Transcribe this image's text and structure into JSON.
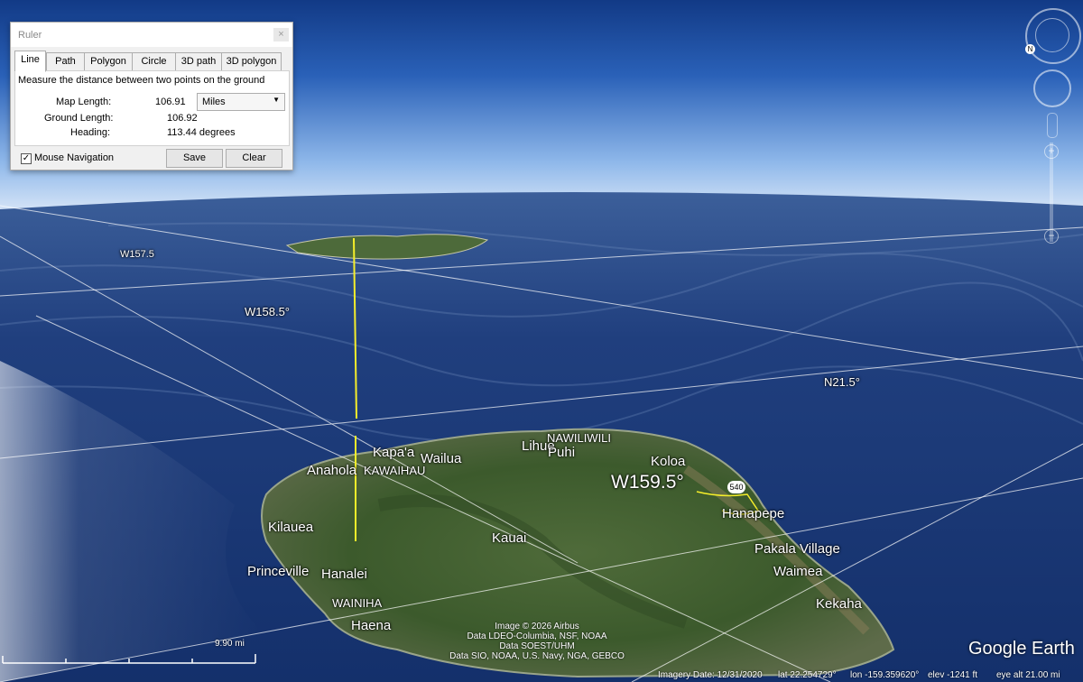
{
  "ruler": {
    "title": "Ruler",
    "tabs": [
      "Line",
      "Path",
      "Polygon",
      "Circle",
      "3D path",
      "3D polygon"
    ],
    "active_tab": "Line",
    "description": "Measure the distance between two points on the ground",
    "map_length_label": "Map Length:",
    "map_length_value": "106.91",
    "units_selected": "Miles",
    "ground_length_label": "Ground Length:",
    "ground_length_value": "106.92",
    "heading_label": "Heading:",
    "heading_value": "113.44 degrees",
    "mouse_navigation_label": "Mouse Navigation",
    "mouse_navigation_checked": true,
    "save_label": "Save",
    "clear_label": "Clear"
  },
  "map": {
    "grid_labels": {
      "w157_5": "W157.5",
      "w158_5": "W158.5°",
      "n21_5": "N21.5°",
      "w159_5": "W159.5°"
    },
    "places": {
      "nawiliwili": "NAWILIWILI",
      "lihue": "Lihue",
      "puhi": "Puhi",
      "kapaa": "Kapa'a",
      "wailua": "Wailua",
      "anahola": "Anahola",
      "kawaihau": "KAWAIHAU",
      "koloa": "Koloa",
      "hanapepe": "Hanapepe",
      "kilauea": "Kilauea",
      "kauai": "Kauai",
      "pakala_village": "Pakala Village",
      "princeville": "Princeville",
      "hanalei": "Hanalei",
      "waimea": "Waimea",
      "wainiha": "WAINIHA",
      "haena": "Haena",
      "kekaha": "Kekaha"
    },
    "road_shield": "540",
    "attribution": [
      "Image © 2026 Airbus",
      "Data LDEO-Columbia, NSF, NOAA",
      "Data SOEST/UHM",
      "Data SIO, NOAA, U.S. Navy, NGA, GEBCO"
    ],
    "logo": "Google Earth",
    "scale_label": "9.90 mi"
  },
  "status": {
    "imagery_date": "Imagery Date: 12/31/2020",
    "lat": "lat   22.254729°",
    "lon": "lon -159.359620°",
    "elev": "elev -1241 ft",
    "eye_alt": "eye alt  21.00 mi"
  },
  "colors": {
    "ruler_line": "#f5ee2a",
    "ocean": "#1b3f82",
    "sky": "#8fb5e6"
  }
}
